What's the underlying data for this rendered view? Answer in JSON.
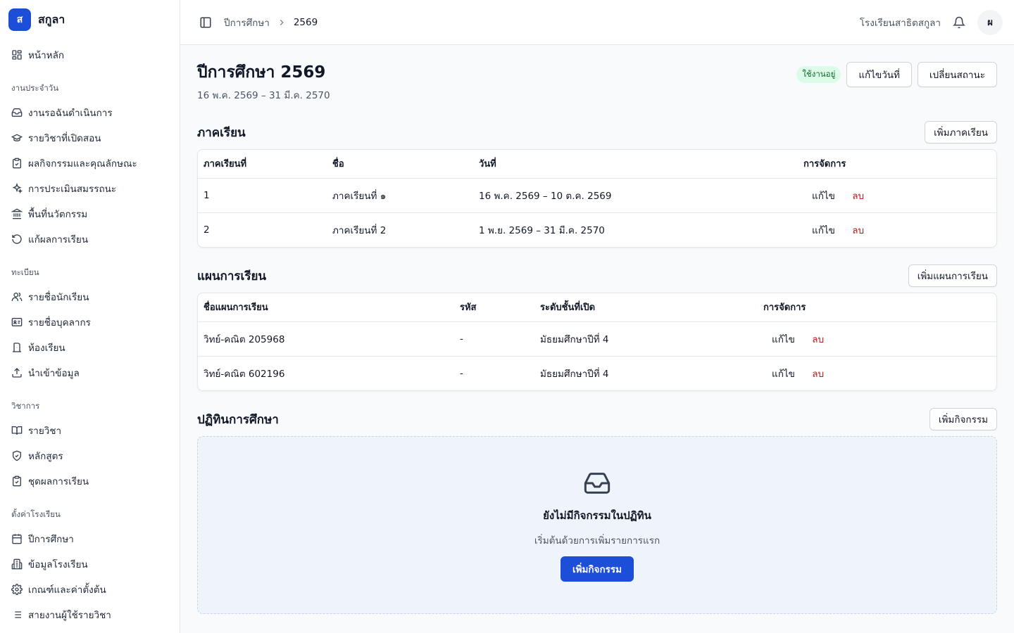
{
  "brand": {
    "logo_letter": "ส",
    "name": "สกูลา"
  },
  "sidebar": {
    "home": {
      "label": "หน้าหลัก",
      "icon": "dashboard-icon"
    },
    "groups": [
      {
        "label": "งานประจำวัน",
        "items": [
          {
            "label": "งานรอฉันดำเนินการ",
            "icon": "inbox-icon"
          },
          {
            "label": "รายวิชาที่เปิดสอน",
            "icon": "graduation-cap-icon"
          },
          {
            "label": "ผลกิจกรรมและคุณลักษณะ",
            "icon": "clipboard-check-icon"
          },
          {
            "label": "การประเมินสมรรถนะ",
            "icon": "sparkles-icon"
          },
          {
            "label": "พื้นที่นวัตกรรม",
            "icon": "landmark-icon"
          },
          {
            "label": "แก้ผลการเรียน",
            "icon": "rotate-ccw-icon"
          }
        ]
      },
      {
        "label": "ทะเบียน",
        "items": [
          {
            "label": "รายชื่อนักเรียน",
            "icon": "users-icon"
          },
          {
            "label": "รายชื่อบุคลากร",
            "icon": "id-card-icon"
          },
          {
            "label": "ห้องเรียน",
            "icon": "door-icon"
          },
          {
            "label": "นำเข้าข้อมูล",
            "icon": "upload-icon"
          }
        ]
      },
      {
        "label": "วิชาการ",
        "items": [
          {
            "label": "รายวิชา",
            "icon": "book-open-icon"
          },
          {
            "label": "หลักสูตร",
            "icon": "shield-check-icon"
          },
          {
            "label": "ชุดผลการเรียน",
            "icon": "clipboard-check-icon"
          }
        ]
      },
      {
        "label": "ตั้งค่าโรงเรียน",
        "items": [
          {
            "label": "ปีการศึกษา",
            "icon": "calendar-icon"
          },
          {
            "label": "ข้อมูลโรงเรียน",
            "icon": "building-icon"
          },
          {
            "label": "เกณฑ์และค่าตั้งต้น",
            "icon": "settings-icon"
          },
          {
            "label": "สายงานผู้ใช้รายวิชา",
            "icon": "list-icon"
          }
        ]
      }
    ]
  },
  "topbar": {
    "breadcrumb": [
      "ปีการศึกษา",
      "2569"
    ],
    "school_name": "โรงเรียนสาธิตสกูลา",
    "avatar_letter": "ผ"
  },
  "page": {
    "title": "ปีการศึกษา 2569",
    "subtitle": "16 พ.ค. 2569 – 31 มี.ค. 2570",
    "status_badge": "ใช้งานอยู่",
    "edit_dates_label": "แก้ไขวันที่",
    "change_status_label": "เปลี่ยนสถานะ"
  },
  "semesters": {
    "title": "ภาคเรียน",
    "add_label": "เพิ่มภาคเรียน",
    "columns": [
      "ภาคเรียนที่",
      "ชื่อ",
      "วันที่",
      "การจัดการ"
    ],
    "rows": [
      {
        "number": "1",
        "name": "ภาคเรียนที่ ๑",
        "dates": "16 พ.ค. 2569 – 10 ต.ค. 2569"
      },
      {
        "number": "2",
        "name": "ภาคเรียนที่ 2",
        "dates": "1 พ.ย. 2569 – 31 มี.ค. 2570"
      }
    ]
  },
  "plans": {
    "title": "แผนการเรียน",
    "add_label": "เพิ่มแผนการเรียน",
    "columns": [
      "ชื่อแผนการเรียน",
      "รหัส",
      "ระดับชั้นที่เปิด",
      "การจัดการ"
    ],
    "rows": [
      {
        "name": "วิทย์-คณิต 205968",
        "code": "-",
        "level": "มัธยมศึกษาปีที่ 4"
      },
      {
        "name": "วิทย์-คณิต 602196",
        "code": "-",
        "level": "มัธยมศึกษาปีที่ 4"
      }
    ]
  },
  "actions": {
    "edit": "แก้ไข",
    "delete": "ลบ"
  },
  "calendar": {
    "title": "ปฏิทินการศึกษา",
    "add_label": "เพิ่มกิจกรรม",
    "empty_title": "ยังไม่มีกิจกรรมในปฏิทิน",
    "empty_sub": "เริ่มต้นด้วยการเพิ่มรายการแรก",
    "empty_button": "เพิ่มกิจกรรม"
  },
  "colors": {
    "primary": "#1d4ed8",
    "danger": "#b91c1c",
    "success_bg": "#dcfce7",
    "success_text": "#166534"
  }
}
